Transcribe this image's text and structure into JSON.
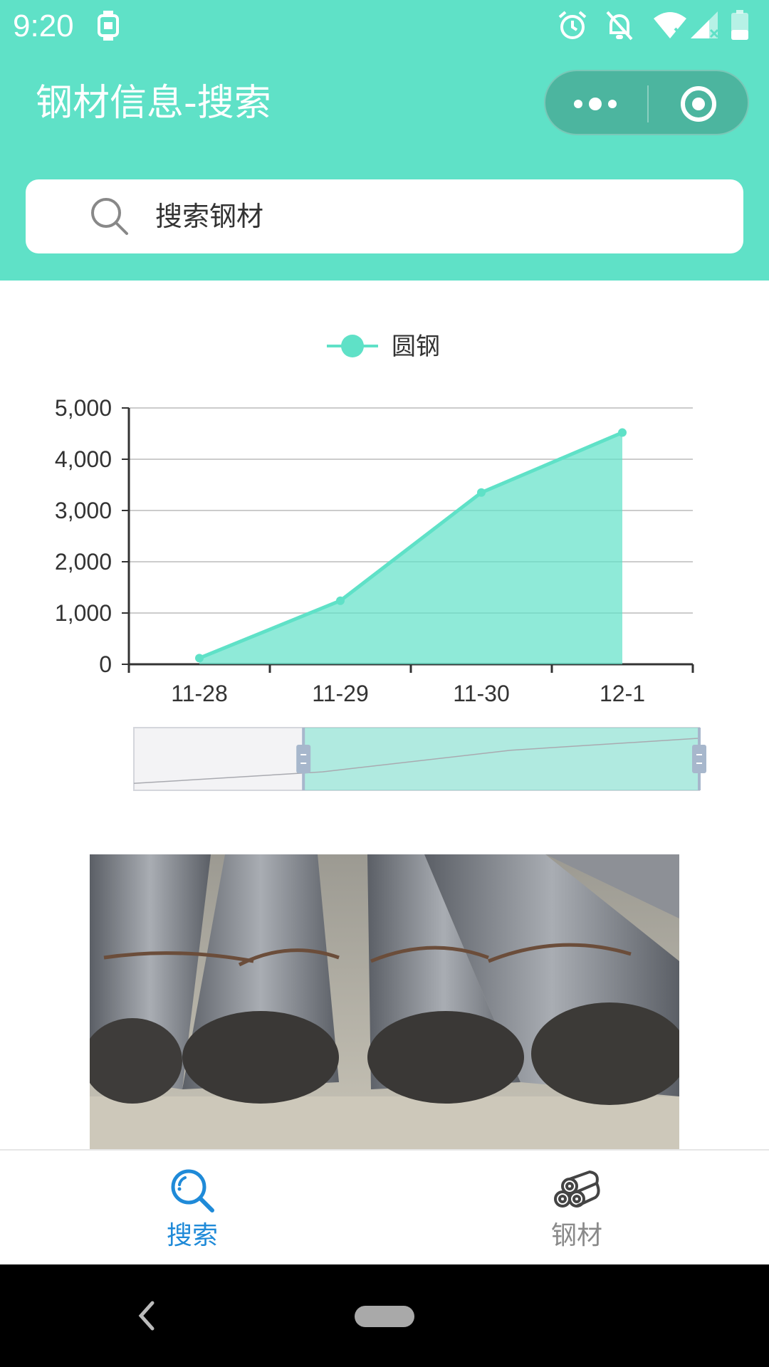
{
  "status_bar": {
    "time": "9:20",
    "icons": [
      "watch-icon",
      "alarm-icon",
      "notifications-off-icon",
      "wifi-icon",
      "signal-icon",
      "battery-icon"
    ]
  },
  "header": {
    "title": "钢材信息-搜索",
    "capsule": {
      "more_icon": "more-dots-icon",
      "close_icon": "target-circle-icon"
    },
    "background_color": "#5fe1c7"
  },
  "search": {
    "placeholder": "搜索钢材",
    "icon": "search-icon"
  },
  "chart_data": {
    "type": "area",
    "title": "",
    "legend": [
      "圆钢"
    ],
    "legend_position": "top-center",
    "categories": [
      "11-28",
      "11-29",
      "11-30",
      "12-1"
    ],
    "series": [
      {
        "name": "圆钢",
        "values": [
          120,
          1240,
          3350,
          4520
        ],
        "color": "#5fe1c7"
      }
    ],
    "ylim": [
      0,
      5000
    ],
    "yticks": [
      "0",
      "1,000",
      "2,000",
      "3,000",
      "4,000",
      "5,000"
    ],
    "grid": true,
    "xlabel": "",
    "ylabel": "",
    "data_zoom": {
      "start_percent": 30,
      "end_percent": 100
    }
  },
  "photo": {
    "subject": "bundles of round steel bars"
  },
  "tabbar": {
    "tabs": [
      {
        "label": "搜索",
        "icon": "search-tab-icon",
        "active": true,
        "color": "#1f8ad8"
      },
      {
        "label": "钢材",
        "icon": "steel-pipes-icon",
        "active": false,
        "color": "#8a8a8a"
      }
    ]
  },
  "nav": {
    "back_icon": "back-chevron-icon",
    "home_icon": "home-pill-icon"
  }
}
